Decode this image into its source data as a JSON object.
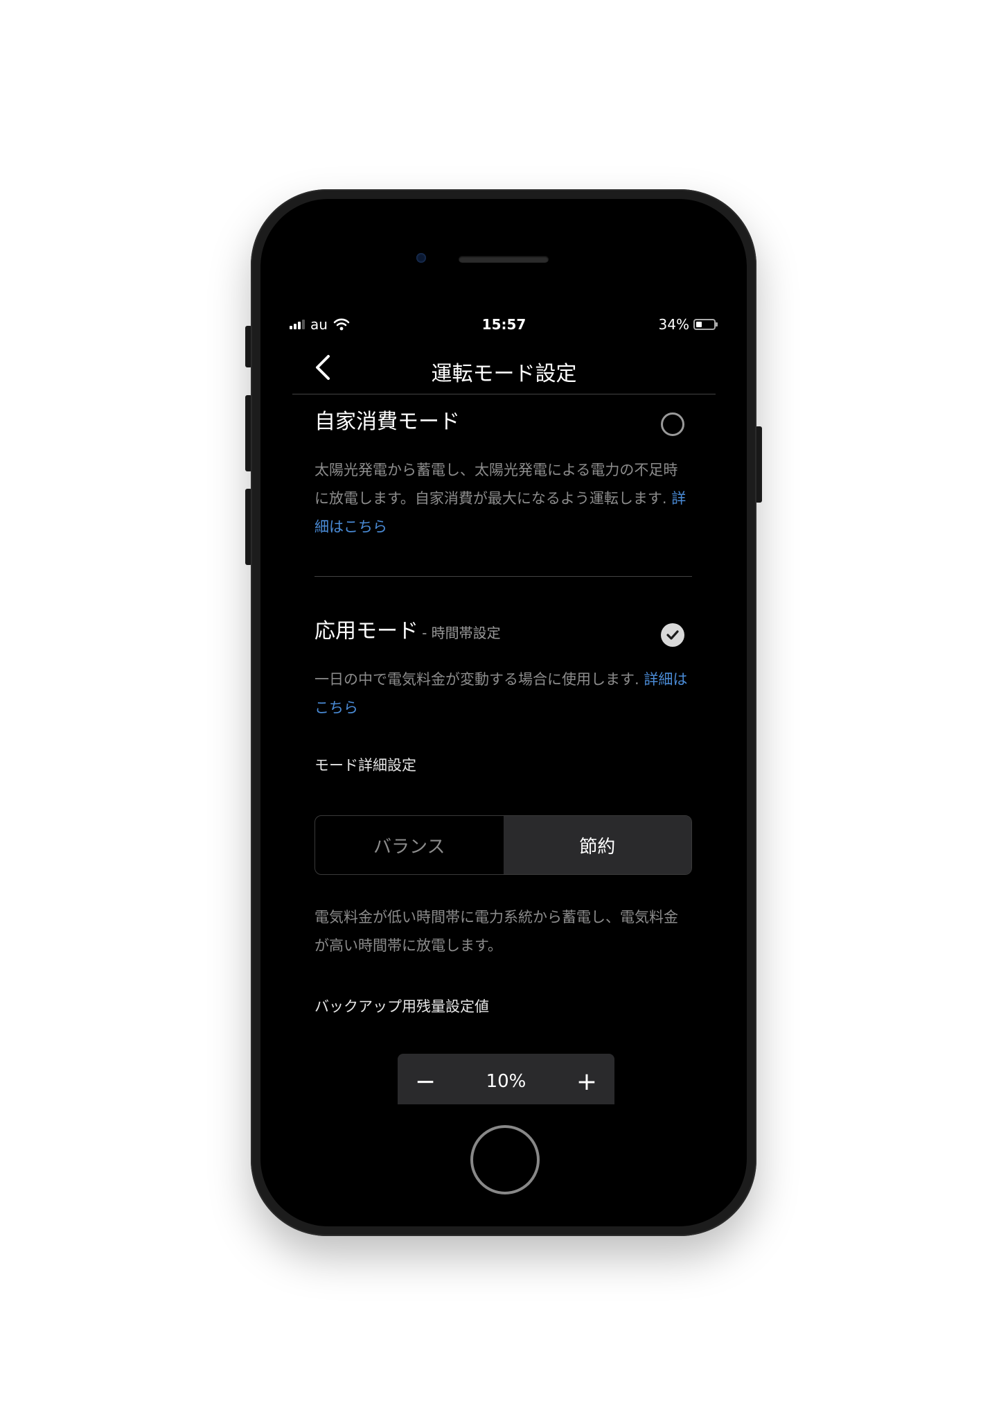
{
  "status_bar": {
    "carrier": "au",
    "time": "15:57",
    "battery": "34%",
    "battery_level": 0.34
  },
  "nav": {
    "title": "運転モード設定"
  },
  "self_consumption": {
    "title": "自家消費モード",
    "selected": false,
    "description": "太陽光発電から蓄電し、太陽光発電による電力の不足時に放電します。自家消費が最大になるよう運転します.",
    "link": "詳細はこちら"
  },
  "applied_mode": {
    "title": "応用モード",
    "subtitle": "- 時間帯設定",
    "selected": true,
    "description": "一日の中で電気料金が変動する場合に使用します.",
    "link": "詳細はこちら"
  },
  "mode_detail": {
    "label": "モード詳細設定",
    "options": [
      "バランス",
      "節約"
    ],
    "selected": "節約",
    "description": "電気料金が低い時間帯に電力系統から蓄電し、電気料金が高い時間帯に放電します。"
  },
  "backup": {
    "label": "バックアップ用残量設定値",
    "value": "10%",
    "decrement": "−",
    "increment": "+"
  }
}
